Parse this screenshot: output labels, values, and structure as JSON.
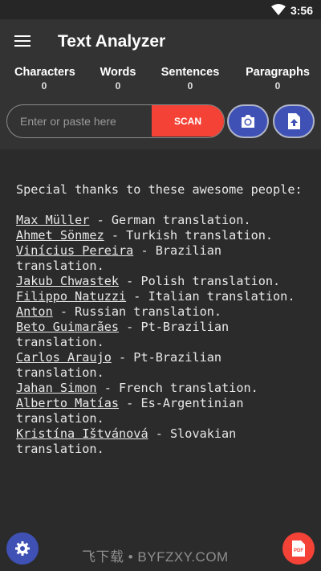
{
  "status_bar": {
    "time": "3:56",
    "wifi_icon": "wifi-icon"
  },
  "app_bar": {
    "title": "Text Analyzer",
    "menu_icon": "hamburger-menu-icon",
    "stats": [
      {
        "label": "Characters",
        "value": "0"
      },
      {
        "label": "Words",
        "value": "0"
      },
      {
        "label": "Sentences",
        "value": "0"
      },
      {
        "label": "Paragraphs",
        "value": "0"
      }
    ]
  },
  "input": {
    "placeholder": "Enter or paste here",
    "value": ""
  },
  "scan_button": {
    "label": "SCAN",
    "color": "#f44336"
  },
  "camera_button": {
    "icon": "camera-icon",
    "color": "#3f51b5"
  },
  "upload_button": {
    "icon": "file-upload-icon",
    "color": "#3f51b5"
  },
  "content": {
    "intro": "Special thanks to these awesome people:",
    "credits": [
      {
        "name": "Max Müller",
        "desc": " - German translation."
      },
      {
        "name": "Ahmet Sönmez",
        "desc": " - Turkish translation."
      },
      {
        "name": "Vinícius Pereira",
        "desc": " - Brazilian translation."
      },
      {
        "name": "Jakub Chwastek",
        "desc": " - Polish translation."
      },
      {
        "name": "Filippo Natuzzi",
        "desc": " - Italian translation."
      },
      {
        "name": "Anton",
        "desc": " - Russian translation."
      },
      {
        "name": "Beto Guimarães",
        "desc": " - Pt-Brazilian translation."
      },
      {
        "name": "Carlos Araujo",
        "desc": " - Pt-Brazilian translation."
      },
      {
        "name": "Jahan Simon",
        "desc": " - French translation."
      },
      {
        "name": "Alberto Matías",
        "desc": " - Es-Argentinian translation."
      },
      {
        "name": "Kristína Ištvánová",
        "desc": " - Slovakian translation."
      }
    ]
  },
  "watermark": "飞下载 • BYFZXY.COM",
  "settings_fab": {
    "icon": "settings-gear-icon",
    "color": "#3f51b5"
  },
  "pdf_fab": {
    "icon": "pdf-icon",
    "label": "PDF",
    "color": "#f44336"
  }
}
